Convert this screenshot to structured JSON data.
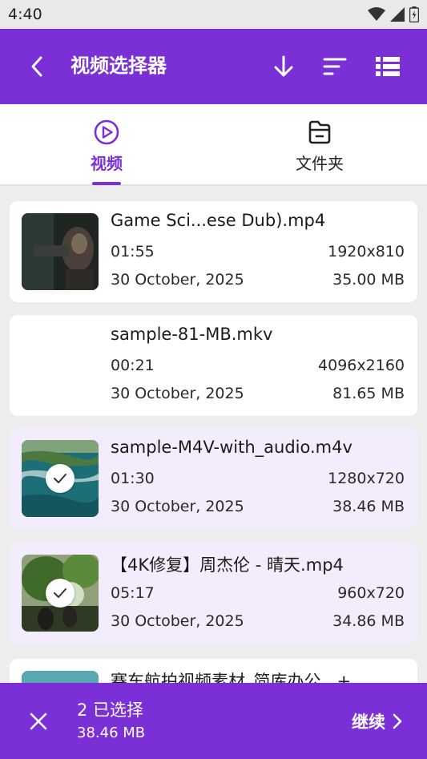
{
  "status": {
    "time": "4:40"
  },
  "app_bar": {
    "title": "视频选择器"
  },
  "tabs": [
    {
      "label": "视频"
    },
    {
      "label": "文件夹"
    }
  ],
  "videos": [
    {
      "name": "Game Sci...ese Dub).mp4",
      "duration": "01:55",
      "resolution": "1920x810",
      "date": "30 October, 2025",
      "size": "35.00 MB",
      "selected": false
    },
    {
      "name": "sample-81-MB.mkv",
      "duration": "00:21",
      "resolution": "4096x2160",
      "date": "30 October, 2025",
      "size": "81.65 MB",
      "selected": false
    },
    {
      "name": "sample-M4V-with_audio.m4v",
      "duration": "01:30",
      "resolution": "1280x720",
      "date": "30 October, 2025",
      "size": "38.46 MB",
      "selected": true
    },
    {
      "name": "【4K修复】周杰伦 - 晴天.mp4",
      "duration": "05:17",
      "resolution": "960x720",
      "date": "30 October, 2025",
      "size": "34.86 MB",
      "selected": true
    },
    {
      "name": "赛车航拍视频素材_简库办公...+",
      "duration": "",
      "resolution": "",
      "date": "",
      "size": "",
      "selected": false
    }
  ],
  "bottom_bar": {
    "selection_count": "2 已选择",
    "selection_size": "38.46 MB",
    "continue_label": "继续"
  },
  "colors": {
    "accent": "#7b2fd6",
    "selected_card": "#f3ecfc"
  },
  "icons": [
    "back-arrow-icon",
    "download-icon",
    "sort-icon",
    "list-view-icon",
    "play-circle-icon",
    "folder-icon",
    "check-icon",
    "close-icon",
    "chevron-right-icon",
    "wifi-icon",
    "signal-icon",
    "battery-icon"
  ]
}
